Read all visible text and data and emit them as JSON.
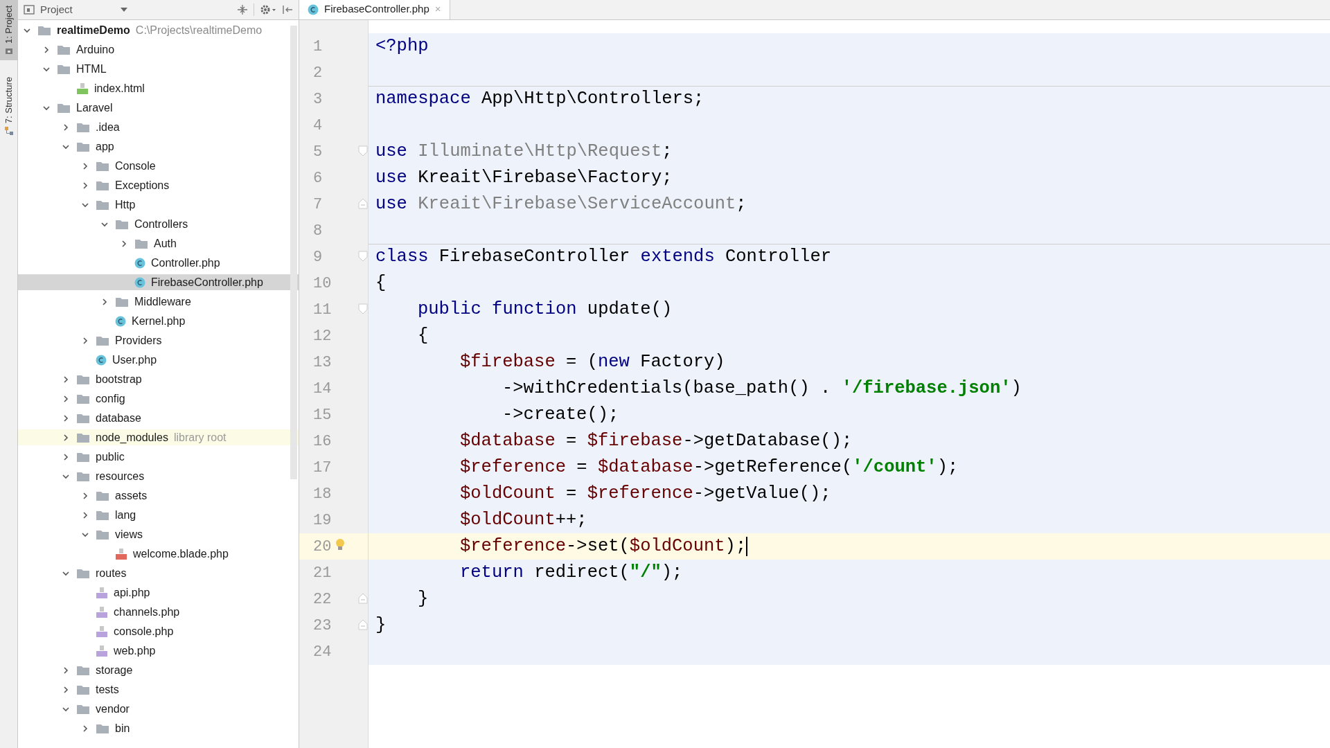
{
  "side_tabs": [
    {
      "label": "1: Project",
      "kind": "project",
      "selected": true
    },
    {
      "label": "7: Structure",
      "kind": "structure",
      "selected": false
    }
  ],
  "project_panel": {
    "view": "Project"
  },
  "tree": [
    {
      "name": "realtimeDemo",
      "path": "C:\\Projects\\realtimeDemo",
      "kind": "project",
      "expanded": true,
      "selected": false,
      "children": [
        {
          "name": "Arduino",
          "kind": "folder",
          "expanded": false,
          "selected": false
        },
        {
          "name": "HTML",
          "kind": "folder",
          "expanded": true,
          "selected": false,
          "children": [
            {
              "name": "index.html",
              "kind": "html",
              "selected": false
            }
          ]
        },
        {
          "name": "Laravel",
          "kind": "folder",
          "expanded": true,
          "selected": false,
          "children": [
            {
              "name": ".idea",
              "kind": "folder",
              "expanded": false,
              "selected": false
            },
            {
              "name": "app",
              "kind": "folder",
              "expanded": true,
              "selected": false,
              "children": [
                {
                  "name": "Console",
                  "kind": "folder",
                  "expanded": false,
                  "selected": false
                },
                {
                  "name": "Exceptions",
                  "kind": "folder",
                  "expanded": false,
                  "selected": false
                },
                {
                  "name": "Http",
                  "kind": "folder",
                  "expanded": true,
                  "selected": false,
                  "children": [
                    {
                      "name": "Controllers",
                      "kind": "folder",
                      "expanded": true,
                      "selected": false,
                      "children": [
                        {
                          "name": "Auth",
                          "kind": "folder",
                          "expanded": false,
                          "selected": false
                        },
                        {
                          "name": "Controller.php",
                          "kind": "class",
                          "selected": false
                        },
                        {
                          "name": "FirebaseController.php",
                          "kind": "class",
                          "selected": true
                        }
                      ]
                    },
                    {
                      "name": "Middleware",
                      "kind": "folder",
                      "expanded": false,
                      "selected": false
                    },
                    {
                      "name": "Kernel.php",
                      "kind": "class",
                      "selected": false
                    }
                  ]
                },
                {
                  "name": "Providers",
                  "kind": "folder",
                  "expanded": false,
                  "selected": false
                },
                {
                  "name": "User.php",
                  "kind": "class",
                  "selected": false
                }
              ]
            },
            {
              "name": "bootstrap",
              "kind": "folder",
              "expanded": false,
              "selected": false
            },
            {
              "name": "config",
              "kind": "folder",
              "expanded": false,
              "selected": false
            },
            {
              "name": "database",
              "kind": "folder",
              "expanded": false,
              "selected": false
            },
            {
              "name": "node_modules",
              "note": "library root",
              "kind": "library",
              "expanded": false,
              "selected": false
            },
            {
              "name": "public",
              "kind": "folder",
              "expanded": false,
              "selected": false
            },
            {
              "name": "resources",
              "kind": "folder",
              "expanded": true,
              "selected": false,
              "children": [
                {
                  "name": "assets",
                  "kind": "folder",
                  "expanded": false,
                  "selected": false
                },
                {
                  "name": "lang",
                  "kind": "folder",
                  "expanded": false,
                  "selected": false
                },
                {
                  "name": "views",
                  "kind": "folder",
                  "expanded": true,
                  "selected": false,
                  "children": [
                    {
                      "name": "welcome.blade.php",
                      "kind": "blade",
                      "selected": false
                    }
                  ]
                }
              ]
            },
            {
              "name": "routes",
              "kind": "folder",
              "expanded": true,
              "selected": false,
              "children": [
                {
                  "name": "api.php",
                  "kind": "php",
                  "selected": false
                },
                {
                  "name": "channels.php",
                  "kind": "php",
                  "selected": false
                },
                {
                  "name": "console.php",
                  "kind": "php",
                  "selected": false
                },
                {
                  "name": "web.php",
                  "kind": "php",
                  "selected": false
                }
              ]
            },
            {
              "name": "storage",
              "kind": "folder",
              "expanded": false,
              "selected": false
            },
            {
              "name": "tests",
              "kind": "folder",
              "expanded": false,
              "selected": false
            },
            {
              "name": "vendor",
              "kind": "folder",
              "expanded": true,
              "selected": false,
              "children": [
                {
                  "name": "bin",
                  "kind": "folder",
                  "expanded": false,
                  "selected": false
                }
              ]
            }
          ]
        }
      ]
    }
  ],
  "editor_tabs": [
    {
      "label": "FirebaseController.php",
      "close": "×",
      "selected": true
    }
  ],
  "code_lines": [
    {
      "number": "1",
      "kind": "top",
      "current": false,
      "separator": false,
      "fold_start": false,
      "fold_end": false,
      "bulb": false,
      "tokens": [
        {
          "kind": "keyword",
          "text": "<?php"
        }
      ]
    },
    {
      "number": "2",
      "kind": "top",
      "current": false,
      "separator": false,
      "fold_start": false,
      "fold_end": false,
      "bulb": false
    },
    {
      "number": "3",
      "kind": "top",
      "current": false,
      "separator": true,
      "fold_start": false,
      "fold_end": false,
      "bulb": false,
      "tokens": [
        {
          "kind": "keyword",
          "text": "namespace"
        },
        {
          "kind": "plain",
          "text": " App\\Http\\Controllers;"
        }
      ]
    },
    {
      "number": "4",
      "kind": "top",
      "current": false,
      "separator": false,
      "fold_start": false,
      "fold_end": false,
      "bulb": false
    },
    {
      "number": "5",
      "kind": "top",
      "current": false,
      "separator": false,
      "fold_start": true,
      "fold_end": false,
      "bulb": false,
      "tokens": [
        {
          "kind": "keyword",
          "text": "use"
        },
        {
          "kind": "unused",
          "text": " Illuminate\\Http\\Request"
        },
        {
          "kind": "plain",
          "text": ";"
        }
      ]
    },
    {
      "number": "6",
      "kind": "top",
      "current": false,
      "separator": false,
      "fold_start": false,
      "fold_end": false,
      "bulb": false,
      "tokens": [
        {
          "kind": "keyword",
          "text": "use"
        },
        {
          "kind": "plain",
          "text": " Kreait\\Firebase\\Factory;"
        }
      ]
    },
    {
      "number": "7",
      "kind": "top",
      "current": false,
      "separator": false,
      "fold_start": false,
      "fold_end": true,
      "bulb": false,
      "tokens": [
        {
          "kind": "keyword",
          "text": "use"
        },
        {
          "kind": "unused",
          "text": " Kreait\\Firebase\\ServiceAccount"
        },
        {
          "kind": "plain",
          "text": ";"
        }
      ]
    },
    {
      "number": "8",
      "kind": "top",
      "current": false,
      "separator": false,
      "fold_start": false,
      "fold_end": false,
      "bulb": false
    },
    {
      "number": "9",
      "kind": "top",
      "current": false,
      "separator": true,
      "fold_start": true,
      "fold_end": false,
      "bulb": false,
      "tokens": [
        {
          "kind": "keyword",
          "text": "class"
        },
        {
          "kind": "plain",
          "text": " FirebaseController "
        },
        {
          "kind": "keyword",
          "text": "extends"
        },
        {
          "kind": "plain",
          "text": " Controller"
        }
      ]
    },
    {
      "number": "10",
      "kind": "top",
      "current": false,
      "separator": false,
      "fold_start": false,
      "fold_end": false,
      "bulb": false,
      "tokens": [
        {
          "kind": "plain",
          "text": "{"
        }
      ]
    },
    {
      "number": "11",
      "kind": "member",
      "current": false,
      "separator": false,
      "fold_start": true,
      "fold_end": false,
      "bulb": false,
      "tokens": [
        {
          "kind": "keyword",
          "text": "public function"
        },
        {
          "kind": "plain",
          "text": " update()"
        }
      ]
    },
    {
      "number": "12",
      "kind": "member",
      "current": false,
      "separator": false,
      "fold_start": false,
      "fold_end": false,
      "bulb": false,
      "tokens": [
        {
          "kind": "plain",
          "text": "{"
        }
      ]
    },
    {
      "number": "13",
      "kind": "statement",
      "current": false,
      "separator": false,
      "fold_start": false,
      "fold_end": false,
      "bulb": false,
      "tokens": [
        {
          "kind": "var",
          "text": "$firebase"
        },
        {
          "kind": "plain",
          "text": " = ("
        },
        {
          "kind": "keyword",
          "text": "new"
        },
        {
          "kind": "plain",
          "text": " Factory)"
        }
      ]
    },
    {
      "number": "14",
      "kind": "continuation",
      "current": false,
      "separator": false,
      "fold_start": false,
      "fold_end": false,
      "bulb": false,
      "tokens": [
        {
          "kind": "plain",
          "text": "->withCredentials(base_path() . "
        },
        {
          "kind": "string",
          "text": "'/firebase.json'"
        },
        {
          "kind": "plain",
          "text": ")"
        }
      ]
    },
    {
      "number": "15",
      "kind": "continuation",
      "current": false,
      "separator": false,
      "fold_start": false,
      "fold_end": false,
      "bulb": false,
      "tokens": [
        {
          "kind": "plain",
          "text": "->create();"
        }
      ]
    },
    {
      "number": "16",
      "kind": "statement",
      "current": false,
      "separator": false,
      "fold_start": false,
      "fold_end": false,
      "bulb": false,
      "tokens": [
        {
          "kind": "var",
          "text": "$database"
        },
        {
          "kind": "plain",
          "text": " = "
        },
        {
          "kind": "var",
          "text": "$firebase"
        },
        {
          "kind": "plain",
          "text": "->getDatabase();"
        }
      ]
    },
    {
      "number": "17",
      "kind": "statement",
      "current": false,
      "separator": false,
      "fold_start": false,
      "fold_end": false,
      "bulb": false,
      "tokens": [
        {
          "kind": "var",
          "text": "$reference"
        },
        {
          "kind": "plain",
          "text": " = "
        },
        {
          "kind": "var",
          "text": "$database"
        },
        {
          "kind": "plain",
          "text": "->getReference("
        },
        {
          "kind": "string",
          "text": "'/count'"
        },
        {
          "kind": "plain",
          "text": ");"
        }
      ]
    },
    {
      "number": "18",
      "kind": "statement",
      "current": false,
      "separator": false,
      "fold_start": false,
      "fold_end": false,
      "bulb": false,
      "tokens": [
        {
          "kind": "var",
          "text": "$oldCount"
        },
        {
          "kind": "plain",
          "text": " = "
        },
        {
          "kind": "var",
          "text": "$reference"
        },
        {
          "kind": "plain",
          "text": "->getValue();"
        }
      ]
    },
    {
      "number": "19",
      "kind": "statement",
      "current": false,
      "separator": false,
      "fold_start": false,
      "fold_end": false,
      "bulb": false,
      "tokens": [
        {
          "kind": "var",
          "text": "$oldCount"
        },
        {
          "kind": "plain",
          "text": "++;"
        }
      ]
    },
    {
      "number": "20",
      "kind": "statement",
      "current": true,
      "separator": false,
      "fold_start": false,
      "fold_end": false,
      "bulb": true,
      "tokens": [
        {
          "kind": "var",
          "text": "$reference"
        },
        {
          "kind": "plain",
          "text": "->set("
        },
        {
          "kind": "var",
          "text": "$oldCount"
        },
        {
          "kind": "plain",
          "text": ");"
        }
      ]
    },
    {
      "number": "21",
      "kind": "statement",
      "current": false,
      "separator": false,
      "fold_start": false,
      "fold_end": false,
      "bulb": false,
      "tokens": [
        {
          "kind": "keyword",
          "text": "return"
        },
        {
          "kind": "plain",
          "text": " redirect("
        },
        {
          "kind": "string",
          "text": "\"/\""
        },
        {
          "kind": "plain",
          "text": ");"
        }
      ]
    },
    {
      "number": "22",
      "kind": "member",
      "current": false,
      "separator": false,
      "fold_start": false,
      "fold_end": true,
      "bulb": false,
      "tokens": [
        {
          "kind": "plain",
          "text": "}"
        }
      ]
    },
    {
      "number": "23",
      "kind": "top",
      "current": false,
      "separator": false,
      "fold_start": false,
      "fold_end": true,
      "bulb": false,
      "tokens": [
        {
          "kind": "plain",
          "text": "}"
        }
      ]
    },
    {
      "number": "24",
      "kind": "top",
      "current": false,
      "separator": false,
      "fold_start": false,
      "fold_end": false,
      "bulb": false
    }
  ]
}
